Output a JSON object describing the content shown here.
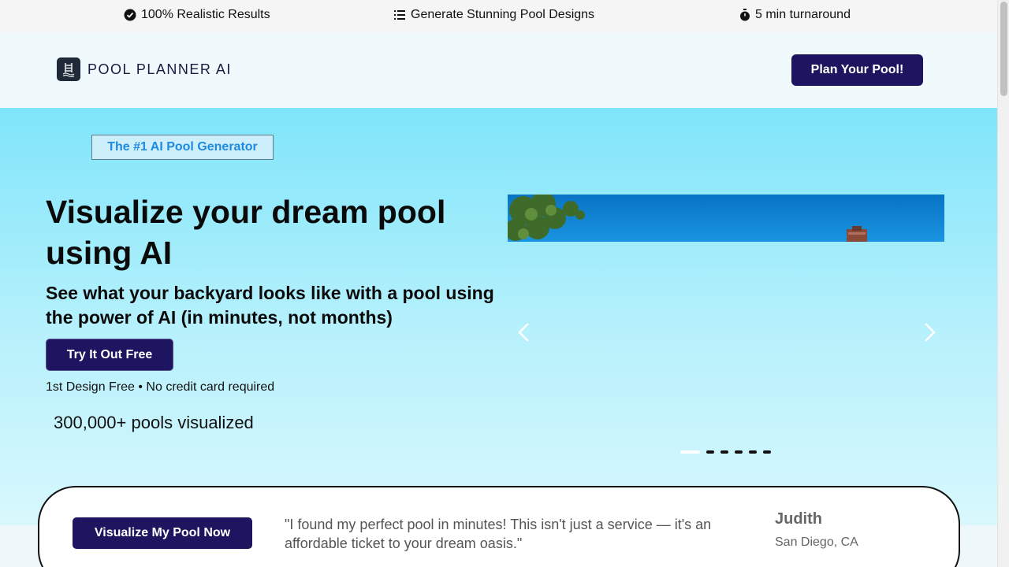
{
  "topbar": {
    "items": [
      {
        "icon": "check-circle-icon",
        "label": "100% Realistic Results"
      },
      {
        "icon": "list-icon",
        "label": "Generate Stunning Pool Designs"
      },
      {
        "icon": "stopwatch-icon",
        "label": "5 min turnaround"
      }
    ]
  },
  "navbar": {
    "logo_text": "POOL PLANNER AI",
    "logo_icon": "pool-ladder-icon",
    "cta_label": "Plan Your Pool!"
  },
  "hero": {
    "badge": "The #1 AI Pool Generator",
    "title": "Visualize your dream pool using AI",
    "subtitle": "See what your backyard looks like with a pool using the power of AI (in minutes, not months)",
    "cta_label": "Try It Out Free",
    "note": "1st Design Free • No credit card required",
    "stat": "300,000+ pools visualized"
  },
  "carousel": {
    "prev_icon": "chevron-left-icon",
    "next_icon": "chevron-right-icon",
    "slide_count": 6,
    "active_slide": 1
  },
  "testimonial": {
    "cta_label": "Visualize My Pool Now",
    "quote": "\"I found my perfect pool in minutes! This isn't just a service — it's an affordable ticket to your dream oasis.\"",
    "author": "Judith",
    "location": "San Diego, CA"
  },
  "colors": {
    "brand_navy": "#1e1560",
    "hero_top": "#7fe5fa",
    "hero_bottom": "#d8f8fd",
    "badge_text": "#1e8ae0"
  }
}
